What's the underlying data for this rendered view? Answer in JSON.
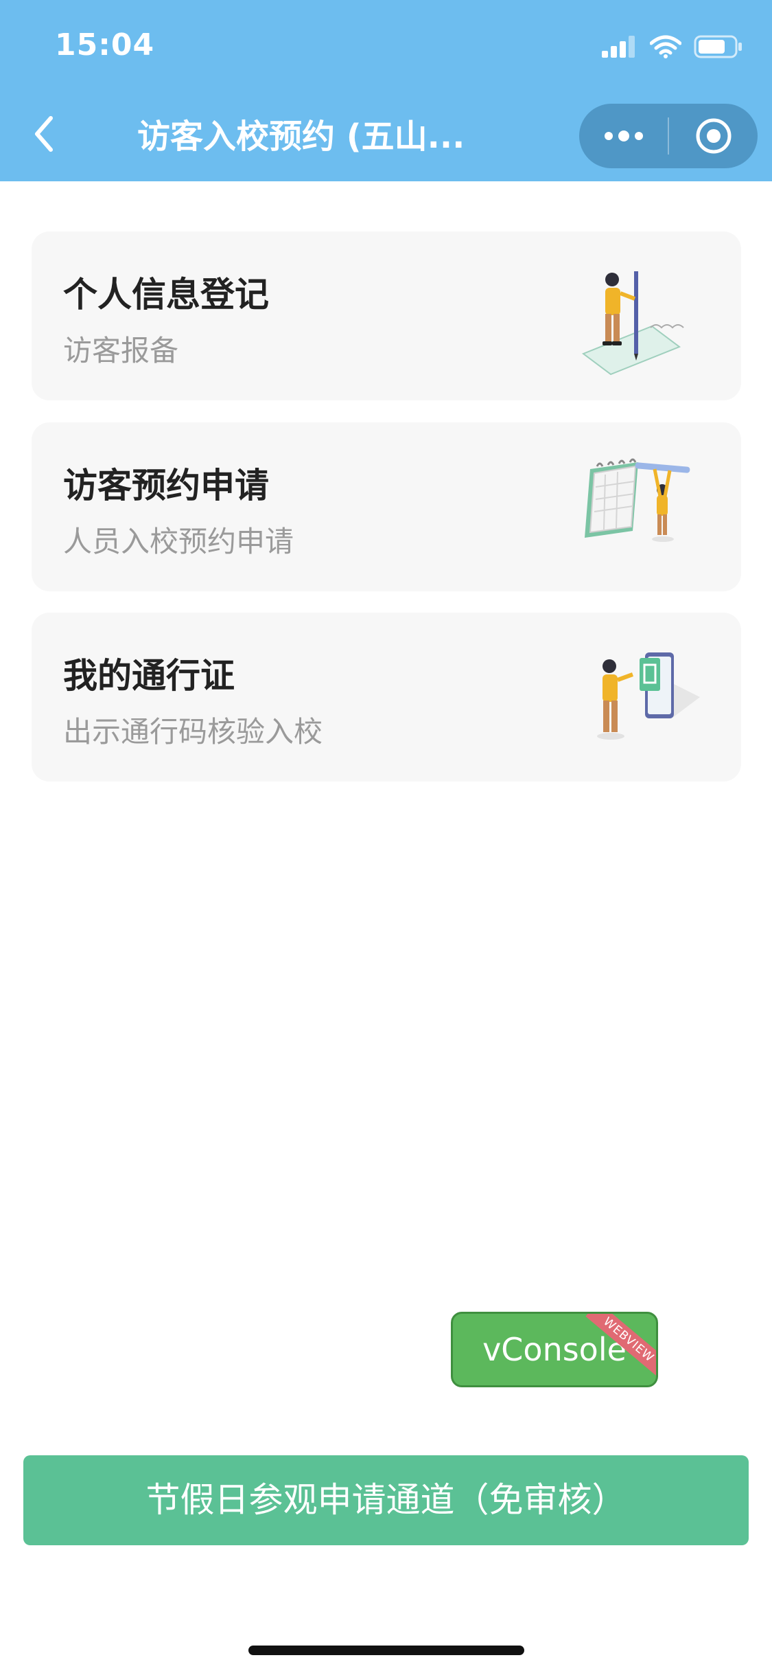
{
  "status_bar": {
    "time": "15:04"
  },
  "nav": {
    "title": "访客入校预约 (五山..."
  },
  "cards": [
    {
      "title": "个人信息登记",
      "subtitle": "访客报备"
    },
    {
      "title": "访客预约申请",
      "subtitle": "人员入校预约申请"
    },
    {
      "title": "我的通行证",
      "subtitle": "出示通行码核验入校"
    }
  ],
  "vconsole": {
    "label": "vConsole",
    "badge": "WEBVIEW"
  },
  "holiday_button": {
    "label": "节假日参观申请通道（免审核）"
  },
  "colors": {
    "nav_bg": "#6dbdef",
    "capsule_bg": "#4f97c6",
    "button_green": "#5bc195",
    "vconsole_green": "#5cb85c"
  }
}
